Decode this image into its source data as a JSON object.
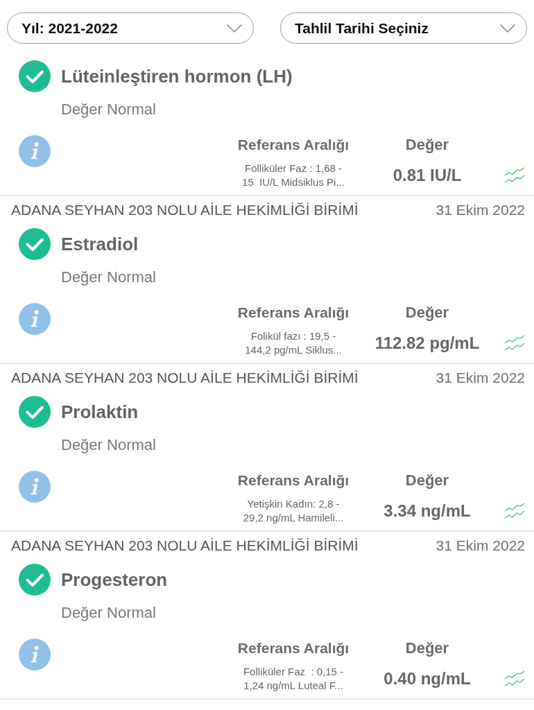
{
  "filters": [
    {
      "label": "Yıl: 2021-2022"
    },
    {
      "label": "Tahlil Tarihi Seçiniz"
    }
  ],
  "results": [
    {
      "test": "Lüteinleştiren hormon (LH)",
      "normal": true,
      "status": "Değer Normal",
      "reference_heading": "Referans Aralığı",
      "value_heading": "Değer",
      "reference": "Folliküler Faz : 1,68 -\n15  IU/L Midsiklus Pi...",
      "value": "0.81 IU/L"
    },
    {
      "facility": "ADANA SEYHAN 203 NOLU AİLE HEKİMLİĞİ BİRİMİ",
      "date": "31 Ekim 2022",
      "test": "Estradiol",
      "normal": true,
      "status": "Değer Normal",
      "reference_heading": "Referans Aralığı",
      "value_heading": "Değer",
      "reference": "Folikül fazı : 19,5 -\n144,2 pg/mL Siklus...",
      "value": "112.82 pg/mL"
    },
    {
      "facility": "ADANA SEYHAN 203 NOLU AİLE HEKİMLİĞİ BİRİMİ",
      "date": "31 Ekim 2022",
      "test": "Prolaktin",
      "normal": true,
      "status": "Değer Normal",
      "reference_heading": "Referans Aralığı",
      "value_heading": "Değer",
      "reference": "Yetişkin Kadın: 2,8 -\n29,2 ng/mL Hamileli...",
      "value": "3.34 ng/mL"
    },
    {
      "facility": "ADANA SEYHAN 203 NOLU AİLE HEKİMLİĞİ BİRİMİ",
      "date": "31 Ekim 2022",
      "test": "Progesteron",
      "normal": true,
      "status": "Değer Normal",
      "reference_heading": "Referans Aralığı",
      "value_heading": "Değer",
      "reference": "Folliküler Faz  : 0,15 -\n1,24 ng/mL Luteal F...",
      "value": "0.40 ng/mL"
    }
  ]
}
